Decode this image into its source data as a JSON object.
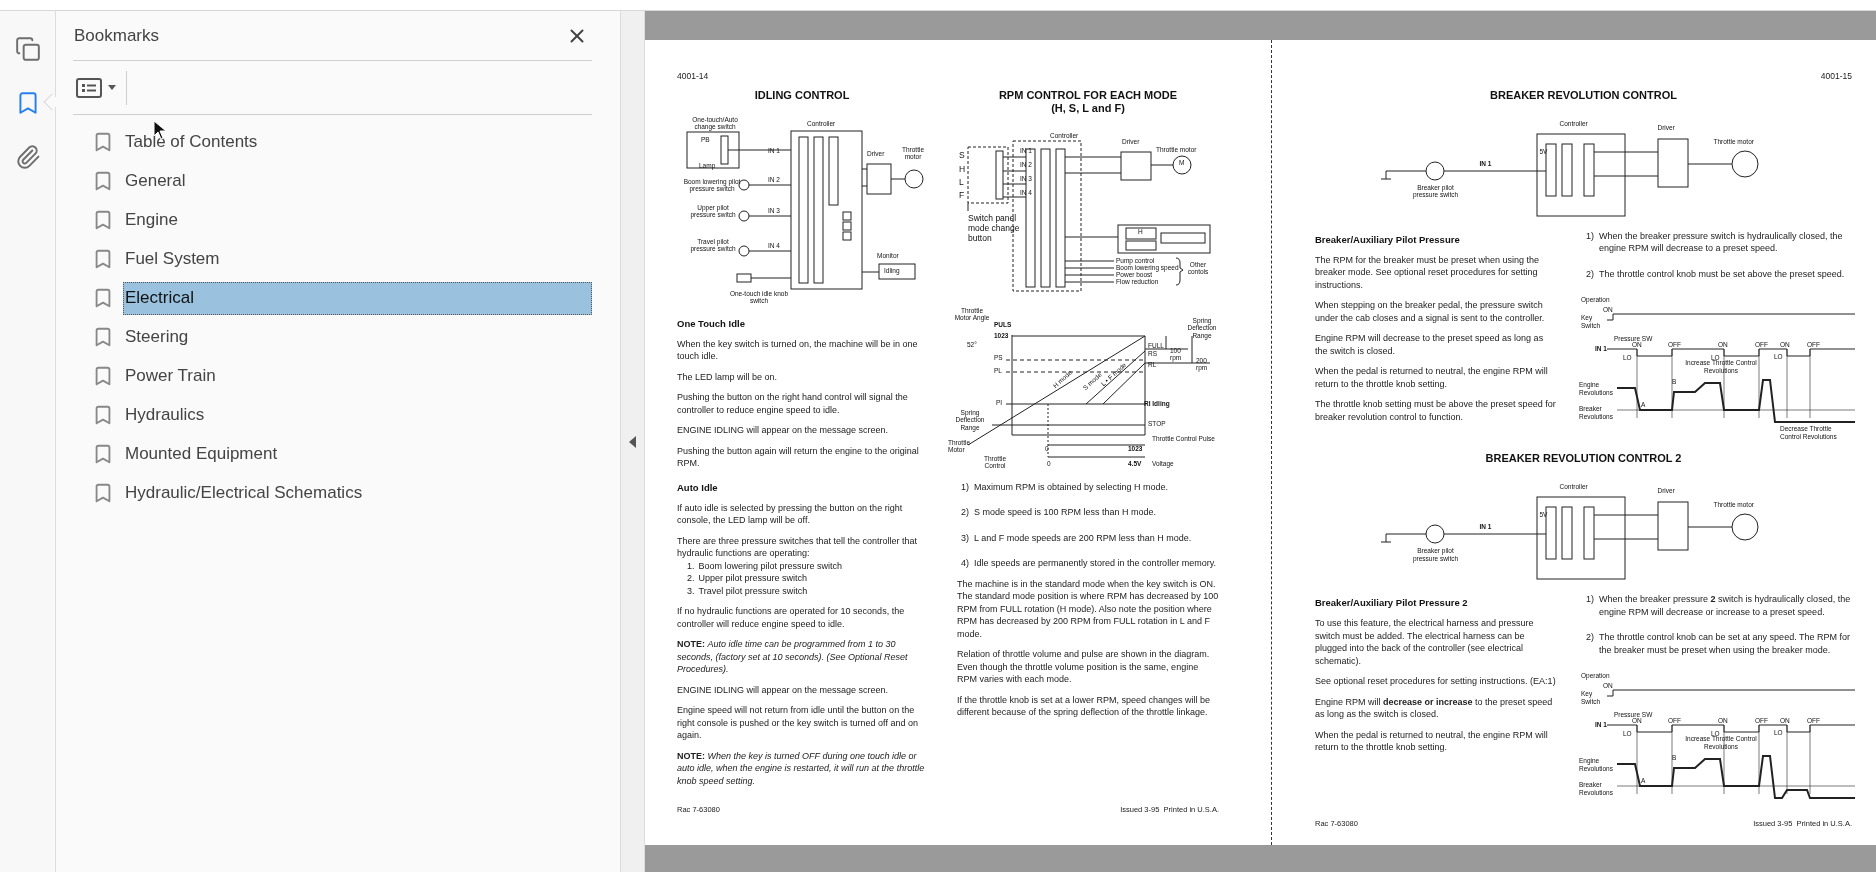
{
  "nav_rail": {
    "items": [
      {
        "kind": "pages",
        "selected": false
      },
      {
        "kind": "bookmarks",
        "selected": true
      },
      {
        "kind": "attachments",
        "selected": false
      }
    ]
  },
  "bookmarks_panel": {
    "title": "Bookmarks",
    "items": [
      {
        "label": "Table of Contents",
        "selected": false
      },
      {
        "label": "General",
        "selected": false
      },
      {
        "label": "Engine",
        "selected": false
      },
      {
        "label": "Fuel System",
        "selected": false
      },
      {
        "label": "Electrical",
        "selected": true
      },
      {
        "label": "Steering",
        "selected": false
      },
      {
        "label": "Power Train",
        "selected": false
      },
      {
        "label": "Hydraulics",
        "selected": false
      },
      {
        "label": "Mounted Equipment",
        "selected": false
      },
      {
        "label": "Hydraulic/Electrical Schematics",
        "selected": false
      }
    ]
  },
  "document": {
    "pages": [
      {
        "page_number": "4001-14",
        "footer_left": "Rac 7-63080",
        "footer_right": "Issued 3-95  Printed in U.S.A.",
        "sections": [
          {
            "columns": [
              [
                {
                  "kind": "title",
                  "lines": [
                    "IDLING CONTROL"
                  ]
                },
                {
                  "kind": "idle",
                  "labels": [
                    "One-touch/Auto change switch",
                    "PB",
                    "Lamp",
                    "Controller",
                    "IN 1",
                    "IN 2",
                    "IN 3",
                    "IN 4",
                    "Driver",
                    "Throttle motor",
                    "Boom lowering pilot pressure switch",
                    "Upper pilot pressure switch",
                    "Travel pilot pressure switch",
                    "Monitor",
                    "Idling",
                    "One-touch idle knob switch"
                  ]
                },
                {
                  "kind": "heading",
                  "text": "One Touch Idle"
                },
                {
                  "kind": "paragraph",
                  "text": "When the key switch is turned on, the machine will be in one touch idle."
                },
                {
                  "kind": "paragraph",
                  "text": "The LED lamp will be on."
                },
                {
                  "kind": "paragraph",
                  "text": "Pushing the button on the right hand control will signal the controller to reduce engine speed to idle."
                },
                {
                  "kind": "paragraph",
                  "text": "ENGINE IDLING will appear on the message screen."
                },
                {
                  "kind": "paragraph",
                  "text": "Pushing the button again will return the engine to the original RPM."
                },
                {
                  "kind": "heading",
                  "text": "Auto Idle"
                },
                {
                  "kind": "paragraph",
                  "text": "If auto idle is selected by pressing the button on the right console, the LED lamp will be off."
                },
                {
                  "kind": "list",
                  "intro": "There are three pressure switches that tell the controller that hydraulic functions are operating:",
                  "items": [
                    {
                      "number": "1.",
                      "text": "Boom lowering pilot pressure switch"
                    },
                    {
                      "number": "2.",
                      "text": "Upper pilot pressure switch"
                    },
                    {
                      "number": "3.",
                      "text": "Travel pilot pressure switch"
                    }
                  ]
                },
                {
                  "kind": "paragraph",
                  "text": "If no hydraulic functions are operated for 10 seconds, the controller will reduce engine speed to idle."
                },
                {
                  "kind": "paragraph",
                  "text": "**NOTE:** *Auto idle time can be programmed from 1 to 30 seconds, (factory set at 10 seconds). (See Optional Reset Procedures).*"
                },
                {
                  "kind": "paragraph",
                  "text": "ENGINE IDLING will appear on the message screen."
                },
                {
                  "kind": "paragraph",
                  "text": "Engine speed will not return from idle until the button on the right console is pushed or the key switch is turned off and on again."
                },
                {
                  "kind": "paragraph",
                  "text": "**NOTE:** *When the key is turned OFF during one touch idle or auto idle, when the engine is restarted, it will run at the throttle knob speed setting.*"
                }
              ],
              [
                {
                  "kind": "title",
                  "lines": [
                    "RPM CONTROL FOR EACH MODE",
                    "(H, S, L and F)"
                  ]
                },
                {
                  "kind": "mode",
                  "labels": [
                    "S",
                    "H",
                    "L",
                    "F",
                    "IN 1",
                    "IN 2",
                    "IN 3",
                    "IN 4",
                    "Controller",
                    "Driver",
                    "Throttle motor",
                    "M",
                    "Switch panel mode change button",
                    "H",
                    "Pump control",
                    "Boom lowering speed",
                    "Power boost",
                    "Flow reduction",
                    "Other contols"
                  ]
                },
                {
                  "kind": "graph",
                  "labels": [
                    "Throttle Motor Angle",
                    "PULS",
                    "1023",
                    "52°",
                    "PS",
                    "PL",
                    "PI",
                    "Spring Deflection Range",
                    "FULL",
                    "RS",
                    "RL",
                    "100 rpm",
                    "200 rpm",
                    "H mode",
                    "S mode",
                    "L • F mode",
                    "RI Idling",
                    "STOP",
                    "Spring Deflection Range",
                    "Throttle Motor",
                    "Throttle Control",
                    "0",
                    "1023",
                    "Throttle Control Pulse",
                    "0",
                    "4.5V",
                    "Voltage"
                  ]
                },
                {
                  "kind": "steps",
                  "items": [
                    {
                      "number": "1)",
                      "text": "Maximum RPM is obtained by selecting H mode."
                    },
                    {
                      "number": "2)",
                      "text": "S mode speed is 100 RPM less than H mode."
                    },
                    {
                      "number": "3)",
                      "text": "L and F mode speeds are 200 RPM less than H mode."
                    },
                    {
                      "number": "4)",
                      "text": "Idle speeds are permanently stored in the controller memory."
                    }
                  ]
                },
                {
                  "kind": "paragraph",
                  "text": "The machine is in the standard mode when the key switch is ON. The standard mode position is where RPM has decreased by 100 RPM from FULL rotation (H mode). Also note the position where RPM has decreased by 200 RPM from FULL rotation in L and F mode."
                },
                {
                  "kind": "paragraph",
                  "text": "Relation of throttle volume and pulse are shown in the diagram. Even though the throttle volume position is the same, engine RPM varies with each mode."
                },
                {
                  "kind": "paragraph",
                  "text": "If the throttle knob is set at a lower RPM, speed changes will be different because of the spring deflection of the throttle linkage."
                }
              ]
            ]
          }
        ]
      },
      {
        "page_number": "4001-15",
        "footer_left": "Rac 7-63080",
        "footer_right": "Issued 3-95  Printed in U.S.A.",
        "sections": [
          {
            "title": [
              "BREAKER REVOLUTION CONTROL"
            ],
            "diagram": {
              "kind": "breaker",
              "labels": [
                "Controller",
                "Driver",
                "Throttle motor",
                "IN 1",
                "5V",
                "Breaker pilot pressure switch"
              ]
            },
            "columns": [
              [
                {
                  "kind": "heading",
                  "text": "Breaker/Auxiliary Pilot Pressure"
                },
                {
                  "kind": "paragraph",
                  "text": "The RPM for the breaker must be preset when using the breaker mode. See optional reset procedures for setting instructions."
                },
                {
                  "kind": "paragraph",
                  "text": "When stepping on the breaker pedal, the pressure switch under the cab closes and a signal is sent to the controller."
                },
                {
                  "kind": "paragraph",
                  "text": "Engine RPM will decrease to the preset speed as long as the switch is closed."
                },
                {
                  "kind": "paragraph",
                  "text": "When the pedal is returned to neutral, the engine RPM will return to the throttle knob setting."
                },
                {
                  "kind": "paragraph",
                  "text": "The throttle knob setting must be above the preset speed for breaker revolution control to function."
                }
              ],
              [
                {
                  "kind": "steps",
                  "items": [
                    {
                      "number": "1)",
                      "text": "When the breaker pressure switch is hydraulically closed, the engine RPM will decrease to a preset speed."
                    },
                    {
                      "number": "2)",
                      "text": "The throttle control knob must be set above the preset speed."
                    }
                  ]
                },
                {
                  "kind": "timing",
                  "labels": [
                    "Operation",
                    "ON",
                    "Key Switch",
                    "Pressure SW",
                    "ON",
                    "OFF",
                    "ON",
                    "OFF",
                    "ON",
                    "OFF",
                    "IN 1",
                    "LO",
                    "LO",
                    "LO",
                    "Increase  Throttle Control Revolutions",
                    "B",
                    "Engine Revolutions",
                    "A",
                    "Breaker Revolutions",
                    "Decrease Throttle Control Revolutions"
                  ]
                }
              ]
            ]
          },
          {
            "title": [
              "BREAKER REVOLUTION CONTROL 2"
            ],
            "diagram": {
              "kind": "breaker",
              "labels": [
                "Controller",
                "Driver",
                "Throttle motor",
                "IN 1",
                "5V",
                "Breaker pilot pressure switch"
              ]
            },
            "columns": [
              [
                {
                  "kind": "heading",
                  "text": "Breaker/Auxiliary Pilot Pressure 2"
                },
                {
                  "kind": "paragraph",
                  "text": "To use this feature, the electrical harness and pressure switch must be added. The electrical harness can be plugged into the back of the controller (see electrical schematic)."
                },
                {
                  "kind": "paragraph",
                  "text": "See optional reset procedures for setting instructions. (EA:1)"
                },
                {
                  "kind": "paragraph",
                  "text": "Engine RPM will **decrease or increase** to the preset speed as long as the switch is closed."
                },
                {
                  "kind": "paragraph",
                  "text": "When the pedal is returned to neutral, the engine RPM will return to the throttle knob setting."
                }
              ],
              [
                {
                  "kind": "steps",
                  "items": [
                    {
                      "number": "1)",
                      "text": "When the breaker pressure **2** switch is hydraulically closed, the engine RPM will decrease or increase to a preset speed."
                    },
                    {
                      "number": "2)",
                      "text": "The throttle control knob can be set at any speed. The RPM for the breaker must be preset when using the breaker mode."
                    }
                  ]
                },
                {
                  "kind": "timing",
                  "labels": [
                    "Operation",
                    "ON",
                    "Key Switch",
                    "Pressure SW",
                    "ON",
                    "OFF",
                    "ON",
                    "OFF",
                    "ON",
                    "OFF",
                    "IN 1",
                    "LO",
                    "LO",
                    "LO",
                    "Increase  Throttle Control Revolutions",
                    "B",
                    "Engine Revolutions",
                    "A",
                    "Breaker Revolutions"
                  ]
                }
              ]
            ]
          }
        ]
      }
    ]
  }
}
